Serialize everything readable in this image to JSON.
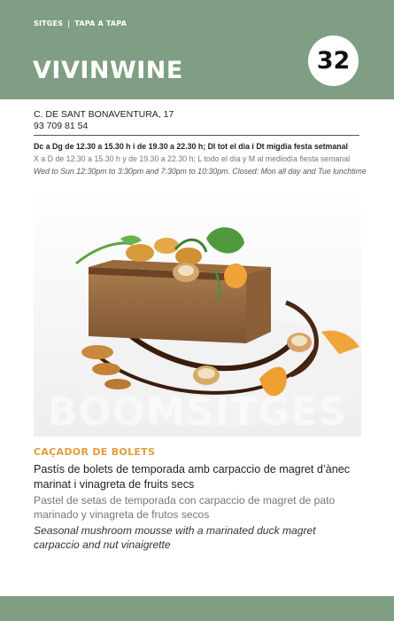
{
  "header": {
    "kicker_left": "SITGES",
    "kicker_sep": "|",
    "kicker_right": "TAPA A TAPA",
    "title": "VIVINWINE",
    "number": "32",
    "background_color": "#7f9e83"
  },
  "venue": {
    "address": "C. DE SANT BONAVENTURA, 17",
    "phone": "93 709 81 54"
  },
  "hours": {
    "catalan": "Dc a Dg de 12.30 a 15.30 h i de 19.30 a 22.30 h; Dl tot el dia i Dt migdia festa setmanal",
    "spanish": "X a D de 12.30 a 15.30 h y de 19.30 a 22.30 h; L todo el día y M al mediodía fiesta semanal",
    "english": "Wed to Sun 12:30pm to 3:30pm and 7:30pm to 10:30pm. Closed: Mon all day and Tue lunchtime"
  },
  "photo": {
    "watermark": "BOOMSITGES"
  },
  "dish": {
    "name": "CAÇADOR DE BOLETS",
    "name_color": "#e59a3a",
    "description_ca": "Pastís de bolets de temporada amb carpaccio de magret d’ànec marinat i vinagreta de fruits secs",
    "description_es": "Pastel de setas de temporada con carpaccio de magret de pato marinado y vinagreta de frutos secos",
    "description_en": "Seasonal mushroom mousse with a marinated duck magret carpaccio and nut vinaigrette"
  }
}
